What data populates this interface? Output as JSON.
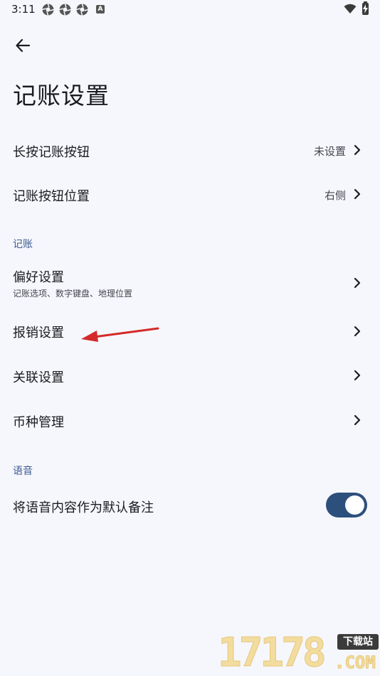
{
  "status_bar": {
    "time": "3:11",
    "app_icons": [
      "aperture-icon",
      "aperture-icon",
      "aperture-icon"
    ],
    "letter_icon": "A",
    "wifi": "wifi-icon",
    "battery": "battery-charging-icon"
  },
  "header": {
    "back_icon": "arrow-back-icon",
    "title": "记账设置"
  },
  "settings": {
    "long_press": {
      "label": "长按记账按钮",
      "value": "未设置"
    },
    "button_position": {
      "label": "记账按钮位置",
      "value": "右侧"
    }
  },
  "section_bookkeeping": {
    "title": "记账",
    "preferences": {
      "label": "偏好设置",
      "subtitle": "记账选项、数字键盘、地理位置"
    },
    "reimbursement": {
      "label": "报销设置"
    },
    "linked": {
      "label": "关联设置"
    },
    "currency": {
      "label": "币种管理"
    }
  },
  "section_voice": {
    "title": "语音",
    "voice_note": {
      "label": "将语音内容作为默认备注",
      "toggle_on": true
    }
  },
  "annotation": {
    "arrow_color": "#d42a2a",
    "points_to": "报销设置"
  },
  "watermark": {
    "digits": "17178",
    "badge": "下载站",
    "suffix": ".COM"
  },
  "colors": {
    "background": "#f6f7fc",
    "accent": "#2d4f7c",
    "section_header": "#3a5a92"
  }
}
